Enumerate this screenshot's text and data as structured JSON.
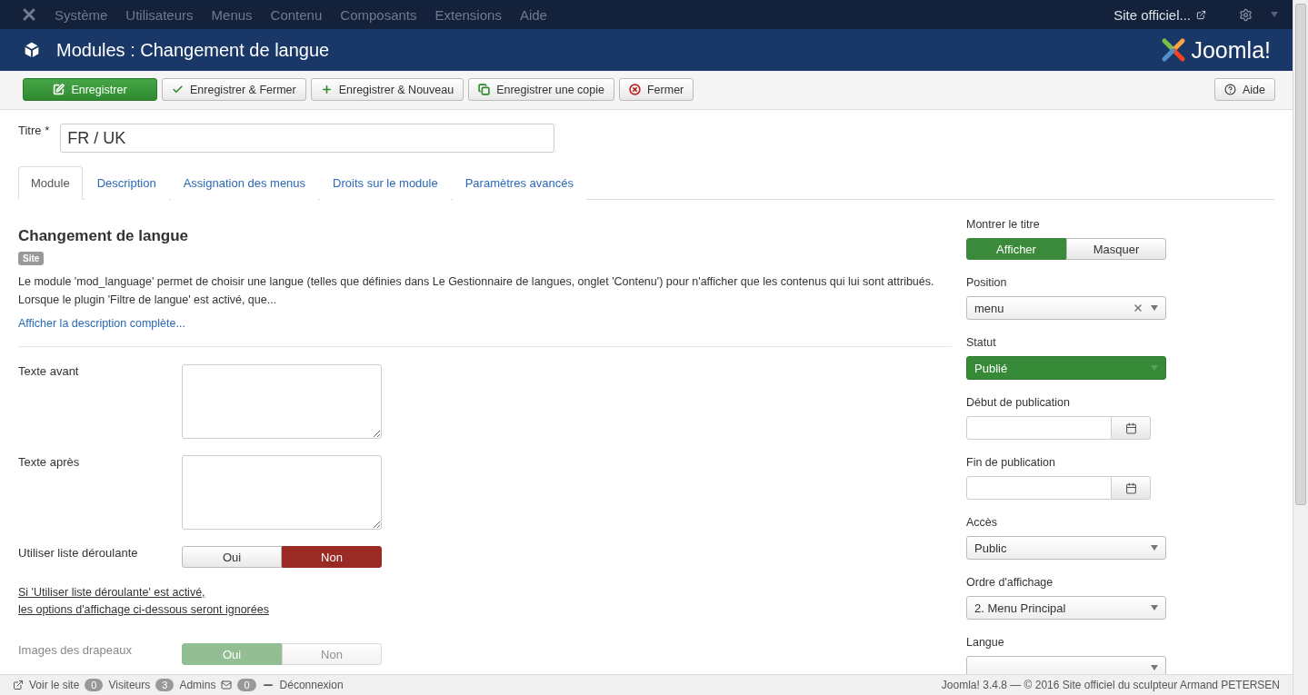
{
  "topmenu": {
    "items": [
      "Système",
      "Utilisateurs",
      "Menus",
      "Contenu",
      "Composants",
      "Extensions",
      "Aide"
    ],
    "site_link": "Site officiel..."
  },
  "header": {
    "title": "Modules : Changement de langue",
    "brand": "Joomla!"
  },
  "toolbar": {
    "buttons": [
      {
        "label": "Enregistrer",
        "kind": "primary"
      },
      {
        "label": "Enregistrer & Fermer",
        "kind": "check"
      },
      {
        "label": "Enregistrer & Nouveau",
        "kind": "plus"
      },
      {
        "label": "Enregistrer une copie",
        "kind": "copy"
      },
      {
        "label": "Fermer",
        "kind": "close"
      }
    ],
    "help": "Aide"
  },
  "title_field": {
    "label": "Titre *",
    "value": "FR / UK"
  },
  "tabs": [
    {
      "label": "Module",
      "selected": true
    },
    {
      "label": "Description",
      "selected": false
    },
    {
      "label": "Assignation des menus",
      "selected": false
    },
    {
      "label": "Droits sur le module",
      "selected": false
    },
    {
      "label": "Paramètres avancés",
      "selected": false
    }
  ],
  "module": {
    "heading": "Changement de langue",
    "badge": "Site",
    "description": "Le module 'mod_language' permet de choisir une langue (telles que définies dans Le Gestionnaire de langues, onglet 'Contenu') pour n'afficher que les contenus qui lui sont attribués. Lorsque le plugin 'Filtre de langue' est activé, que...",
    "more_link": "Afficher la description complète..."
  },
  "fields": [
    {
      "kind": "textarea",
      "label": "Texte avant",
      "disabled": false
    },
    {
      "kind": "textarea",
      "label": "Texte après",
      "disabled": false
    },
    {
      "kind": "toggle",
      "label": "Utiliser liste déroulante",
      "disabled": false,
      "options": [
        {
          "label": "Oui",
          "selected": false
        },
        {
          "label": "Non",
          "selected": true
        }
      ]
    },
    {
      "kind": "note",
      "lines": [
        "Si 'Utiliser liste déroulante' est activé,",
        "les options d'affichage ci-dessous seront ignorées"
      ]
    },
    {
      "kind": "toggle",
      "label": "Images des drapeaux",
      "disabled": true,
      "options": [
        {
          "label": "Oui",
          "selected": true
        },
        {
          "label": "Non",
          "selected": false
        }
      ]
    }
  ],
  "sidebar": [
    {
      "kind": "toggle",
      "label": "Montrer le titre",
      "options": [
        {
          "label": "Afficher",
          "selected": true
        },
        {
          "label": "Masquer",
          "selected": false
        }
      ]
    },
    {
      "kind": "select",
      "label": "Position",
      "value": "menu",
      "clearable": true,
      "published": false
    },
    {
      "kind": "select",
      "label": "Statut",
      "value": "Publié",
      "clearable": false,
      "published": true
    },
    {
      "kind": "date",
      "label": "Début de publication"
    },
    {
      "kind": "date",
      "label": "Fin de publication"
    },
    {
      "kind": "select",
      "label": "Accès",
      "value": "Public",
      "clearable": false,
      "published": false
    },
    {
      "kind": "select",
      "label": "Ordre d'affichage",
      "value": "2. Menu Principal",
      "clearable": false,
      "published": false
    },
    {
      "kind": "select",
      "label": "Langue"
    }
  ],
  "status_bar": {
    "view_site": "Voir le site",
    "visitors_count": "0",
    "visitors": "Visiteurs",
    "admins_count": "3",
    "admins": "Admins",
    "messages_count": "0",
    "logout": "Déconnexion",
    "footer": "Joomla! 3.4.8  —  © 2016 Site officiel du sculpteur Armand PETERSEN"
  }
}
